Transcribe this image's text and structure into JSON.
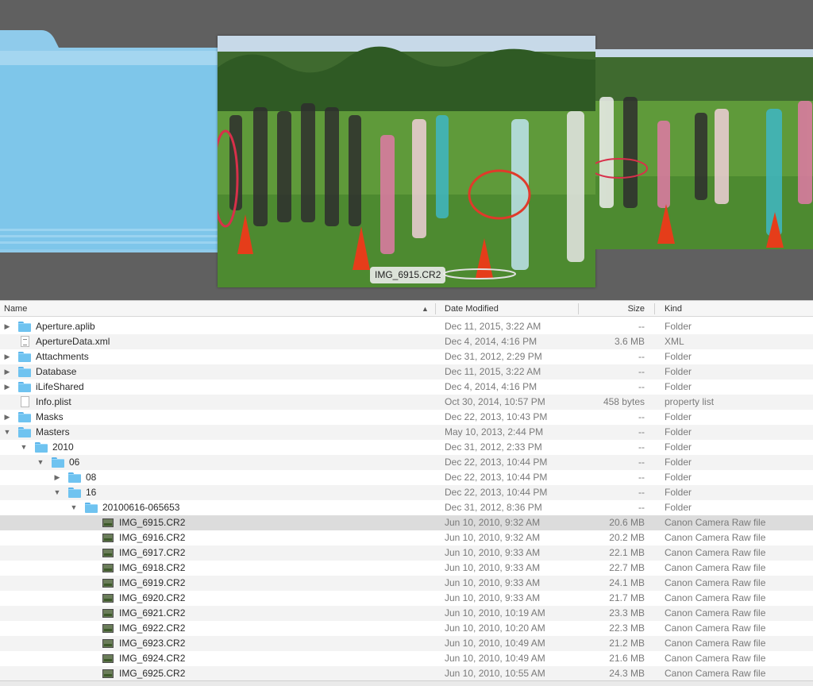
{
  "preview": {
    "caption": "IMG_6915.CR2"
  },
  "columns": {
    "name": "Name",
    "date": "Date Modified",
    "size": "Size",
    "kind": "Kind"
  },
  "rows": [
    {
      "name": "Aperture.aplib",
      "date": "Dec 11, 2015, 3:22 AM",
      "size": "--",
      "kind": "Folder"
    },
    {
      "name": "ApertureData.xml",
      "date": "Dec 4, 2014, 4:16 PM",
      "size": "3.6 MB",
      "kind": "XML"
    },
    {
      "name": "Attachments",
      "date": "Dec 31, 2012, 2:29 PM",
      "size": "--",
      "kind": "Folder"
    },
    {
      "name": "Database",
      "date": "Dec 11, 2015, 3:22 AM",
      "size": "--",
      "kind": "Folder"
    },
    {
      "name": "iLifeShared",
      "date": "Dec 4, 2014, 4:16 PM",
      "size": "--",
      "kind": "Folder"
    },
    {
      "name": "Info.plist",
      "date": "Oct 30, 2014, 10:57 PM",
      "size": "458 bytes",
      "kind": "property list"
    },
    {
      "name": "Masks",
      "date": "Dec 22, 2013, 10:43 PM",
      "size": "--",
      "kind": "Folder"
    },
    {
      "name": "Masters",
      "date": "May 10, 2013, 2:44 PM",
      "size": "--",
      "kind": "Folder"
    },
    {
      "name": "2010",
      "date": "Dec 31, 2012, 2:33 PM",
      "size": "--",
      "kind": "Folder"
    },
    {
      "name": "06",
      "date": "Dec 22, 2013, 10:44 PM",
      "size": "--",
      "kind": "Folder"
    },
    {
      "name": "08",
      "date": "Dec 22, 2013, 10:44 PM",
      "size": "--",
      "kind": "Folder"
    },
    {
      "name": "16",
      "date": "Dec 22, 2013, 10:44 PM",
      "size": "--",
      "kind": "Folder"
    },
    {
      "name": "20100616-065653",
      "date": "Dec 31, 2012, 8:36 PM",
      "size": "--",
      "kind": "Folder"
    },
    {
      "name": "IMG_6915.CR2",
      "date": "Jun 10, 2010, 9:32 AM",
      "size": "20.6 MB",
      "kind": "Canon Camera Raw file"
    },
    {
      "name": "IMG_6916.CR2",
      "date": "Jun 10, 2010, 9:32 AM",
      "size": "20.2 MB",
      "kind": "Canon Camera Raw file"
    },
    {
      "name": "IMG_6917.CR2",
      "date": "Jun 10, 2010, 9:33 AM",
      "size": "22.1 MB",
      "kind": "Canon Camera Raw file"
    },
    {
      "name": "IMG_6918.CR2",
      "date": "Jun 10, 2010, 9:33 AM",
      "size": "22.7 MB",
      "kind": "Canon Camera Raw file"
    },
    {
      "name": "IMG_6919.CR2",
      "date": "Jun 10, 2010, 9:33 AM",
      "size": "24.1 MB",
      "kind": "Canon Camera Raw file"
    },
    {
      "name": "IMG_6920.CR2",
      "date": "Jun 10, 2010, 9:33 AM",
      "size": "21.7 MB",
      "kind": "Canon Camera Raw file"
    },
    {
      "name": "IMG_6921.CR2",
      "date": "Jun 10, 2010, 10:19 AM",
      "size": "23.3 MB",
      "kind": "Canon Camera Raw file"
    },
    {
      "name": "IMG_6922.CR2",
      "date": "Jun 10, 2010, 10:20 AM",
      "size": "22.3 MB",
      "kind": "Canon Camera Raw file"
    },
    {
      "name": "IMG_6923.CR2",
      "date": "Jun 10, 2010, 10:49 AM",
      "size": "21.2 MB",
      "kind": "Canon Camera Raw file"
    },
    {
      "name": "IMG_6924.CR2",
      "date": "Jun 10, 2010, 10:49 AM",
      "size": "21.6 MB",
      "kind": "Canon Camera Raw file"
    },
    {
      "name": "IMG_6925.CR2",
      "date": "Jun 10, 2010, 10:55 AM",
      "size": "24.3 MB",
      "kind": "Canon Camera Raw file"
    }
  ]
}
